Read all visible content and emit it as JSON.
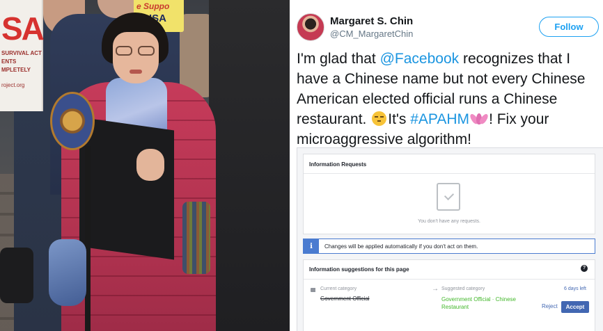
{
  "photo": {
    "sign_left_big": "SA",
    "sign_left_lines": [
      "SURVIVAL ACT",
      "ENTS",
      "MPLETELY",
      "roject.org"
    ],
    "sign_right_top": "e Suppo",
    "sign_right_bottom": "ISA"
  },
  "tweet": {
    "author_name": "Margaret S. Chin",
    "author_handle": "@CM_MargaretChin",
    "follow_label": "Follow",
    "text": {
      "pre_mention": "I'm glad that ",
      "mention": "@Facebook",
      "line1_rest": " recognizes that I",
      "line2": "have a Chinese name but not every Chinese",
      "line3": "American elected official runs a Chinese",
      "line4_pre": "restaurant. ",
      "line4_mid": "It's ",
      "hashtag": "#APAHM",
      "line4_post": "! Fix your",
      "line5": "microaggressive algorithm!"
    },
    "emojis": [
      "unamused-face-emoji",
      "lotus-emoji"
    ]
  },
  "fb_card": {
    "requests_title": "Information Requests",
    "requests_empty": "You don't have any requests.",
    "notice_icon": "i",
    "notice_text": "Changes will be applied automatically if you don't act on them.",
    "suggestions_title": "Information suggestions for this page",
    "help_icon": "?",
    "current_label": "Current category",
    "current_value": "Government Official",
    "arrow": "→",
    "suggested_label": "Suggested category",
    "suggested_value": "Government Official · Chinese Restaurant",
    "time_left": "6 days left",
    "reject_label": "Reject",
    "accept_label": "Accept"
  },
  "colors": {
    "link": "#1b95e0",
    "follow": "#1da1f2",
    "fb_blue": "#4267b2",
    "suggested_green": "#42b72a",
    "coat": "#c63b5a"
  }
}
